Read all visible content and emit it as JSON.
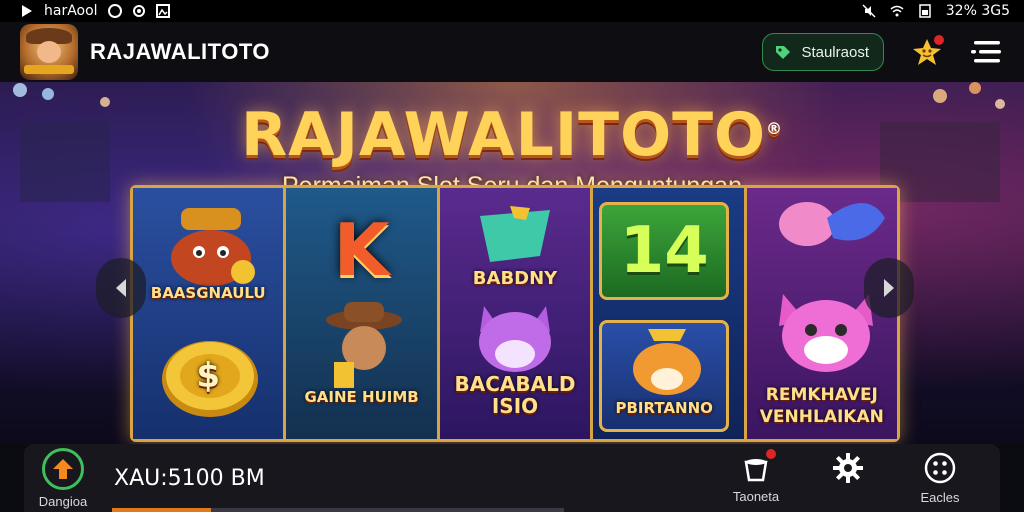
{
  "status_bar": {
    "app_name": "harAool",
    "right_text": "32% 3G5"
  },
  "header": {
    "title": "RAJAWALITOTO",
    "pill_label": "Staulraost"
  },
  "hero": {
    "title": "RAJAWALITOTO",
    "title_mark": "®",
    "subtitle": "Permaiman Slot Seru dan Menguntungan",
    "symbols": {
      "reel1_top": "BAASGNAULU",
      "reel2_top": "K",
      "reel2_bottom": "GAINE HUIMB",
      "reel3_top": "BABDNY",
      "reel3_bottom_line1": "BACABALD",
      "reel3_bottom_line2": "ISIO",
      "reel4_top": "14",
      "reel4_bottom": "PBIRTANNO",
      "reel5_bottom_line1": "REMKHAVEJ",
      "reel5_bottom_line2": "VENHLAIKAN",
      "coin": "$"
    }
  },
  "bottom_bar": {
    "home_label": "Dangioa",
    "balance": "XAU:5100 BM",
    "item1_label": "Taoneta",
    "item3_label": "Eacles",
    "progress": 0.22
  },
  "colors": {
    "accent_gold": "#ffd25a",
    "accent_green": "#3fbf5c",
    "badge_red": "#e02525",
    "progress_orange": "#e07a20"
  }
}
